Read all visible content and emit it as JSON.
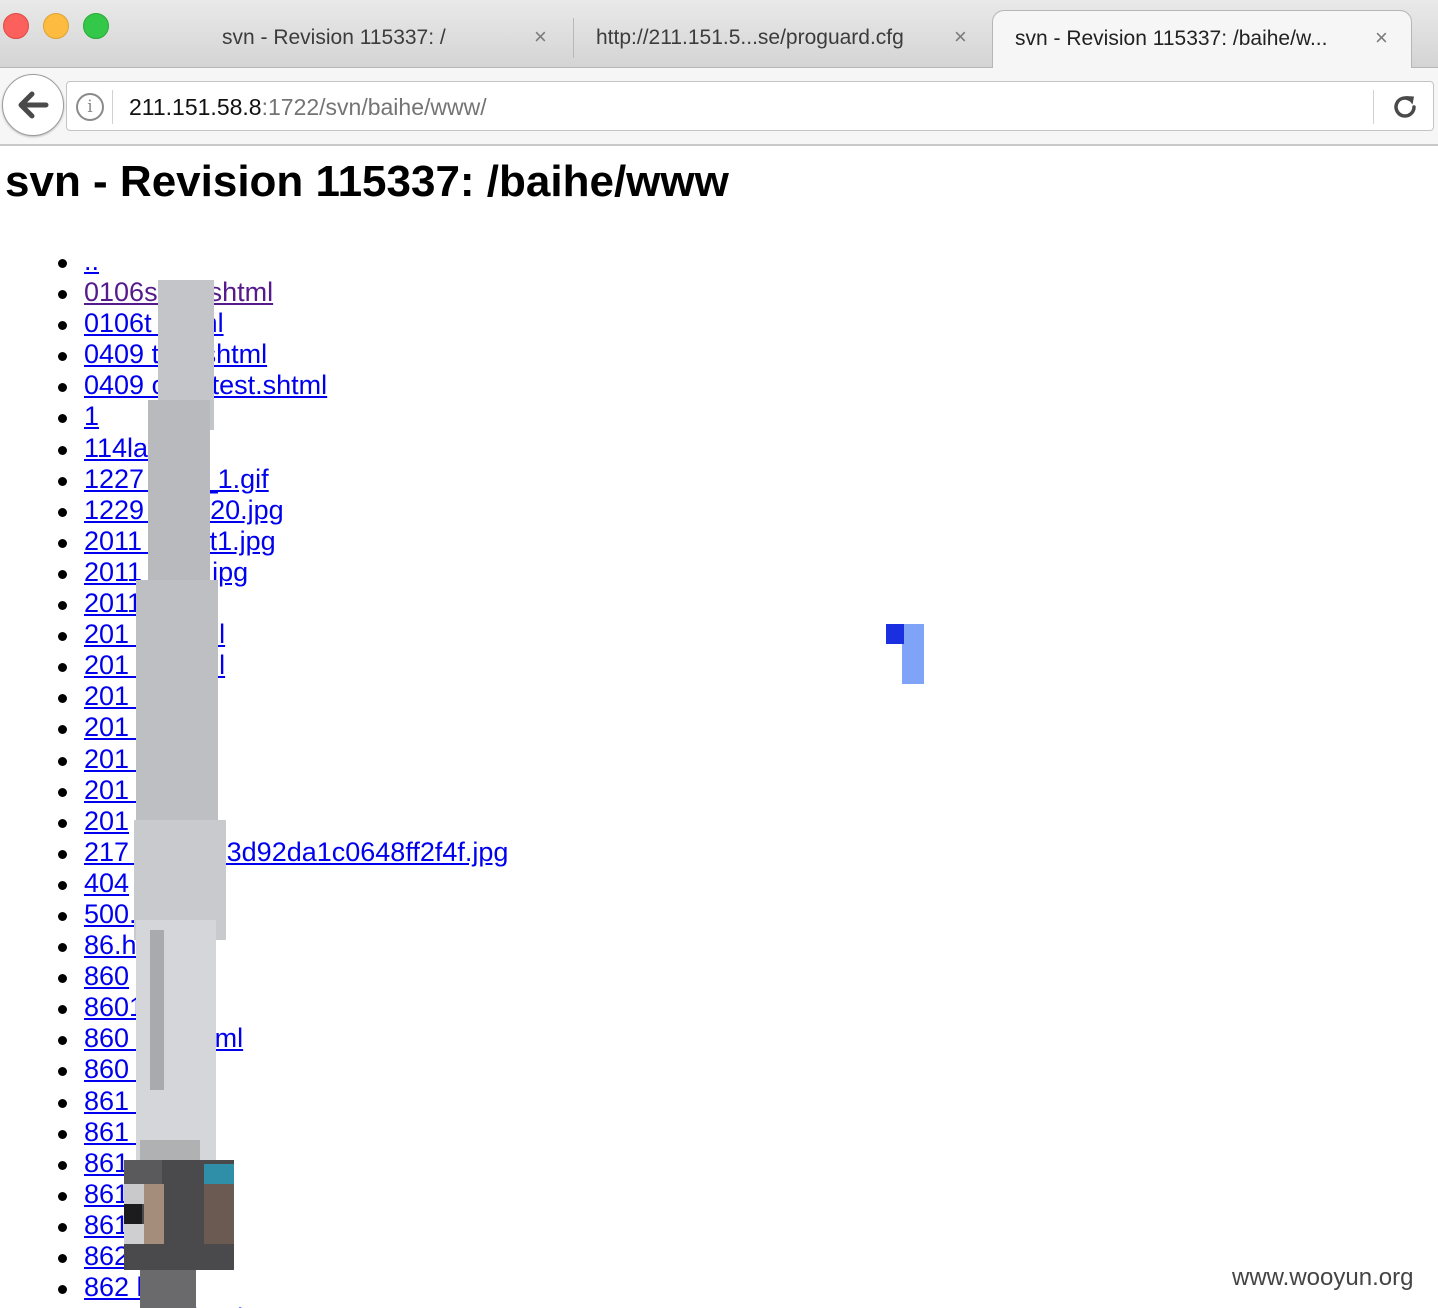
{
  "browser": {
    "tabs": [
      {
        "title": "svn - Revision 115337: /",
        "close": "×",
        "active": false
      },
      {
        "title": "http://211.151.5...se/proguard.cfg",
        "close": "×",
        "active": false
      },
      {
        "title": "svn - Revision 115337: /baihe/w...",
        "close": "×",
        "active": true
      }
    ],
    "address": {
      "host": "211.151.58.8",
      "rest": ":1722/svn/baihe/www/"
    },
    "icons": [
      "back-arrow-icon",
      "info-icon",
      "reload-icon"
    ]
  },
  "page": {
    "heading": "svn - Revision 115337: /baihe/www",
    "entries": [
      "..",
      "0106s      est.shtml",
      "0106t     shtml",
      "0409        test.shtml",
      "0409        ode_test.shtml",
      "1",
      "114la",
      "1227        aihe_1.gif",
      "1229        60x120.jpg",
      "2011          _bhdt1.jpg",
      "2011          _blty.jpg",
      "2011",
      "201             01.html",
      "201             02.html",
      "201              1.jpg",
      "201              1.jpg",
      "201              2.jpg",
      "201             03.jpg",
      "201",
      "217           44026d3d92da1c0648ff2f4f.jpg",
      "404",
      "500.ht",
      "86.h",
      "860",
      "8601        tml",
      "860           new.html",
      "860           w.html",
      "861         ml",
      "861           ml",
      "861           w.html",
      "861           ml",
      "861          html",
      "862",
      "862         html",
      "862         new.html"
    ],
    "visited_index": 1
  },
  "watermark": "www.wooyun.org",
  "colors": {
    "link": "#0000ee",
    "visited": "#551a8b"
  }
}
